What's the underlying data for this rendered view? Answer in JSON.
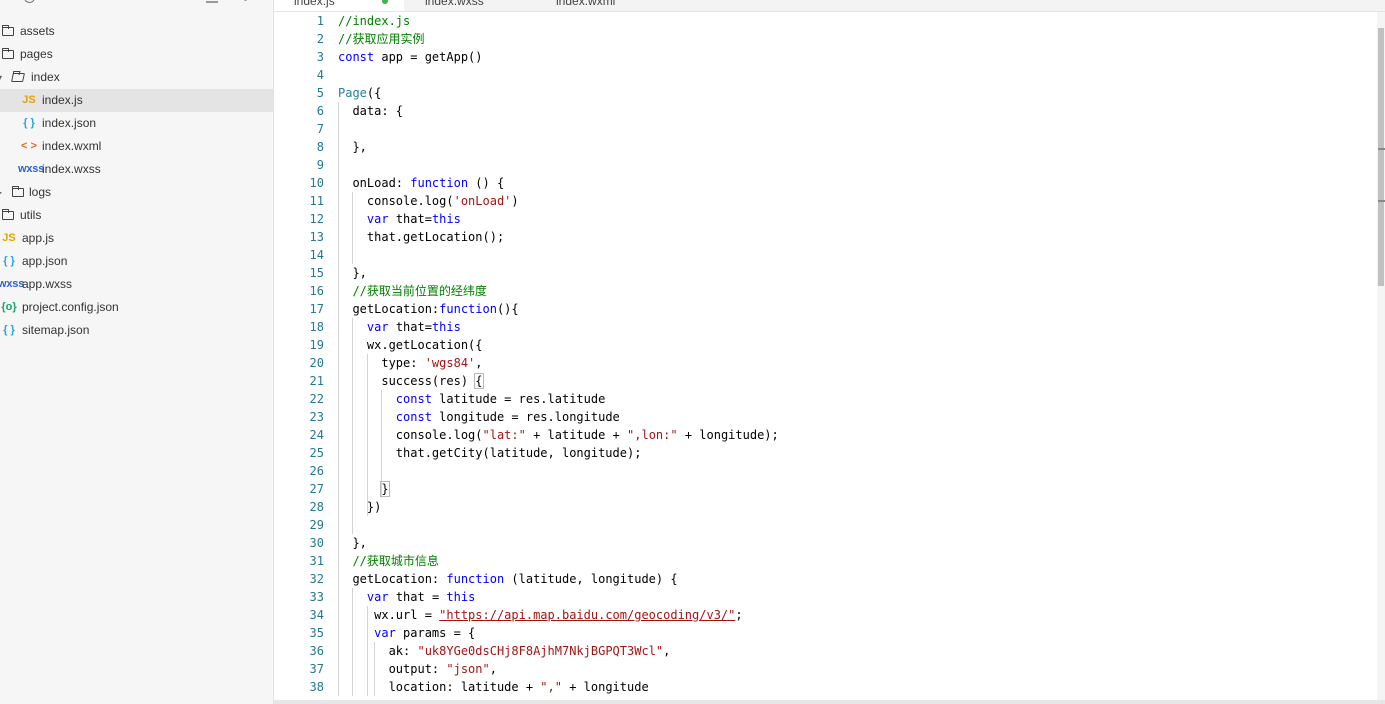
{
  "sidebar": {
    "items": [
      {
        "label": "assets",
        "icon": "folder-icon",
        "depth": 0,
        "kind": "folder"
      },
      {
        "label": "pages",
        "icon": "folder-icon",
        "depth": 0,
        "kind": "folder"
      },
      {
        "label": "index",
        "icon": "folder-open-icon",
        "depth": 0,
        "kind": "folder-open",
        "caret": "▾"
      },
      {
        "label": "index.js",
        "icon": "js-icon",
        "glyph": "JS",
        "depth": 1,
        "kind": "file",
        "active": true
      },
      {
        "label": "index.json",
        "icon": "json-icon",
        "glyph": "{ }",
        "depth": 1,
        "kind": "file"
      },
      {
        "label": "index.wxml",
        "icon": "wxml-icon",
        "glyph": "< >",
        "depth": 1,
        "kind": "file"
      },
      {
        "label": "index.wxss",
        "icon": "wxss-icon",
        "glyph": "wxss",
        "depth": 1,
        "kind": "file"
      },
      {
        "label": "logs",
        "icon": "folder-icon",
        "depth": 0,
        "kind": "folder",
        "caret": "▸"
      },
      {
        "label": "utils",
        "icon": "folder-icon",
        "depth": 0,
        "kind": "folder"
      },
      {
        "label": "app.js",
        "icon": "js-icon",
        "glyph": "JS",
        "depth": 0,
        "kind": "file"
      },
      {
        "label": "app.json",
        "icon": "json-icon",
        "glyph": "{ }",
        "depth": 0,
        "kind": "file"
      },
      {
        "label": "app.wxss",
        "icon": "wxss-icon",
        "glyph": "wxss",
        "depth": 0,
        "kind": "file"
      },
      {
        "label": "project.config.json",
        "icon": "config-icon",
        "glyph": "{o}",
        "depth": 0,
        "kind": "file"
      },
      {
        "label": "sitemap.json",
        "icon": "json-icon",
        "glyph": "{ }",
        "depth": 0,
        "kind": "file"
      }
    ]
  },
  "tabs": [
    {
      "label": "index.js",
      "active": true
    },
    {
      "label": "index.wxss",
      "active": false
    },
    {
      "label": "index.wxml",
      "active": false
    }
  ],
  "colors": {
    "comment": "#008000",
    "keyword": "#0000ff",
    "string": "#a31515",
    "class": "#267f99",
    "line_number": "#237893",
    "modified_dot": "#3bb54a"
  },
  "editor": {
    "lines": [
      [
        [
          "cm",
          "//index.js"
        ]
      ],
      [
        [
          "cm",
          "//获取应用实例"
        ]
      ],
      [
        [
          "kw",
          "const"
        ],
        [
          "",
          " app = getApp()"
        ]
      ],
      [],
      [
        [
          "cls",
          "Page"
        ],
        [
          "",
          "({"
        ]
      ],
      [
        [
          "",
          "  data: {"
        ]
      ],
      [],
      [
        [
          "",
          "  },"
        ]
      ],
      [],
      [
        [
          "",
          "  onLoad: "
        ],
        [
          "kw",
          "function"
        ],
        [
          "",
          " () {"
        ]
      ],
      [
        [
          "",
          "    console.log("
        ],
        [
          "str",
          "'onLoad'"
        ],
        [
          "",
          ")"
        ]
      ],
      [
        [
          "",
          "    "
        ],
        [
          "kw",
          "var"
        ],
        [
          "",
          " that="
        ],
        [
          "kw",
          "this"
        ]
      ],
      [
        [
          "",
          "    that.getLocation();"
        ]
      ],
      [],
      [
        [
          "",
          "  },"
        ]
      ],
      [
        [
          "cm",
          "  //获取当前位置的经纬度"
        ]
      ],
      [
        [
          "",
          "  getLocation:"
        ],
        [
          "kw",
          "function"
        ],
        [
          "",
          "(){"
        ]
      ],
      [
        [
          "",
          "    "
        ],
        [
          "kw",
          "var"
        ],
        [
          "",
          " that="
        ],
        [
          "kw",
          "this"
        ]
      ],
      [
        [
          "",
          "    wx.getLocation({"
        ]
      ],
      [
        [
          "",
          "      type: "
        ],
        [
          "str",
          "'wgs84'"
        ],
        [
          "",
          ","
        ]
      ],
      [
        [
          "",
          "      success(res) "
        ],
        [
          "bm",
          "{"
        ]
      ],
      [
        [
          "",
          "        "
        ],
        [
          "kw",
          "const"
        ],
        [
          "",
          " latitude = res.latitude"
        ]
      ],
      [
        [
          "",
          "        "
        ],
        [
          "kw",
          "const"
        ],
        [
          "",
          " longitude = res.longitude"
        ]
      ],
      [
        [
          "",
          "        console.log("
        ],
        [
          "str",
          "\"lat:\""
        ],
        [
          "",
          " + latitude + "
        ],
        [
          "str",
          "\",lon:\""
        ],
        [
          "",
          " + longitude);"
        ]
      ],
      [
        [
          "",
          "        that.getCity(latitude, longitude);"
        ]
      ],
      [],
      [
        [
          "",
          "      "
        ],
        [
          "bm",
          "}"
        ]
      ],
      [
        [
          "",
          "    })"
        ]
      ],
      [],
      [
        [
          "",
          "  },"
        ]
      ],
      [
        [
          "cm",
          "  //获取城市信息"
        ]
      ],
      [
        [
          "",
          "  getLocation: "
        ],
        [
          "kw",
          "function"
        ],
        [
          "",
          " (latitude, longitude) {"
        ]
      ],
      [
        [
          "",
          "    "
        ],
        [
          "kw",
          "var"
        ],
        [
          "",
          " that = "
        ],
        [
          "kw",
          "this"
        ]
      ],
      [
        [
          "",
          "     wx.url = "
        ],
        [
          "url",
          "\"https://api.map.baidu.com/geocoding/v3/\""
        ],
        [
          "",
          ";"
        ]
      ],
      [
        [
          "",
          "     "
        ],
        [
          "kw",
          "var"
        ],
        [
          "",
          " params = {"
        ]
      ],
      [
        [
          "",
          "       ak: "
        ],
        [
          "str",
          "\"uk8YGe0dsCHj8F8AjhM7NkjBGPQT3Wcl\""
        ],
        [
          "",
          ","
        ]
      ],
      [
        [
          "",
          "       output: "
        ],
        [
          "str",
          "\"json\""
        ],
        [
          "",
          ","
        ]
      ],
      [
        [
          "",
          "       location: latitude + "
        ],
        [
          "str",
          "\",\""
        ],
        [
          "",
          " + longitude"
        ]
      ]
    ]
  }
}
